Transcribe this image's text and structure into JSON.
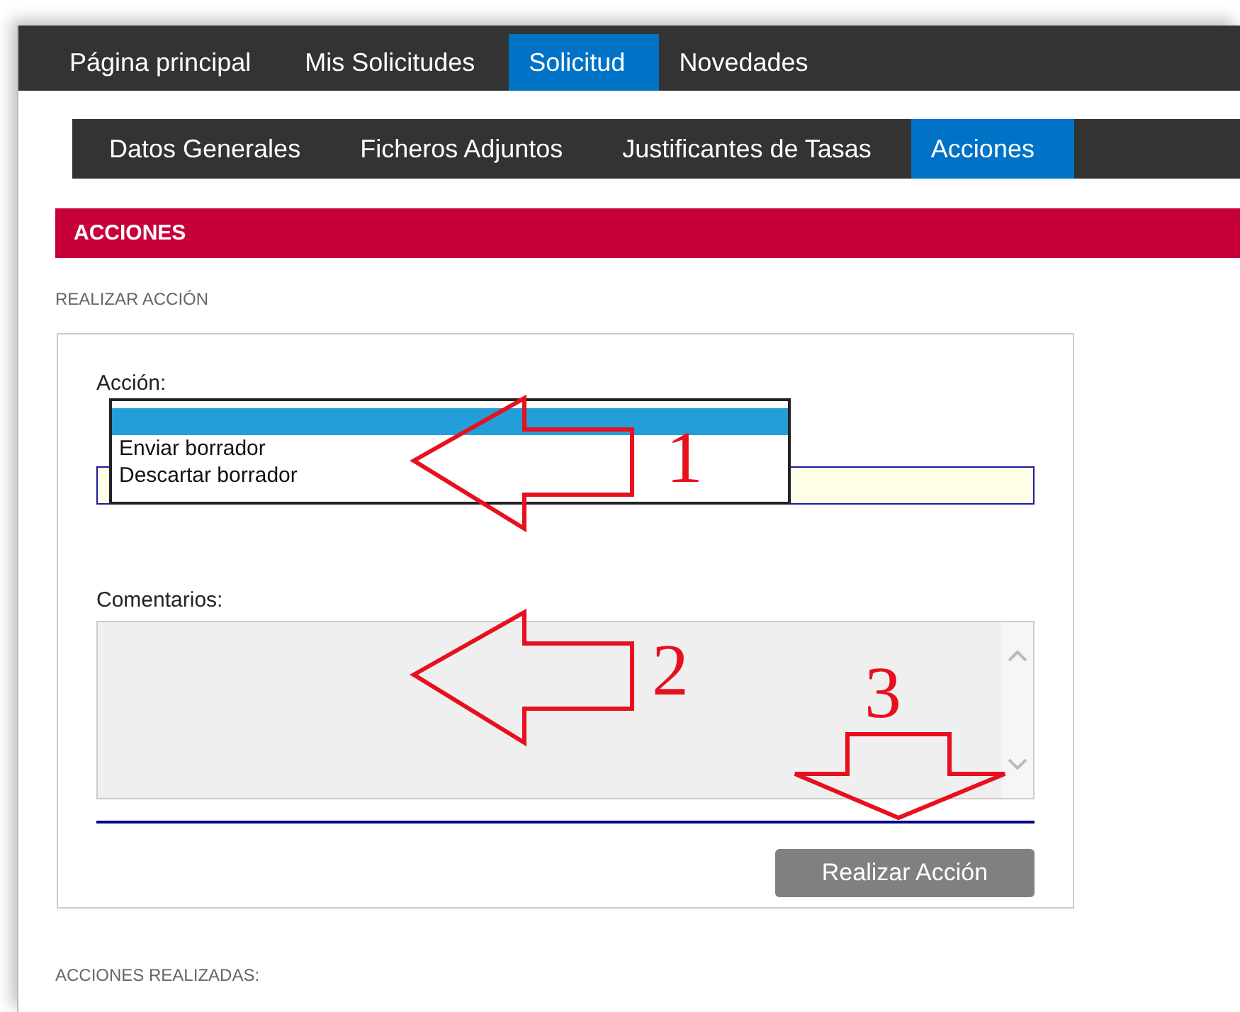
{
  "main_nav": [
    {
      "label": "Página principal",
      "selected": false
    },
    {
      "label": "Mis Solicitudes",
      "selected": false
    },
    {
      "label": "Solicitud",
      "selected": true
    },
    {
      "label": "Novedades",
      "selected": false
    }
  ],
  "sub_nav": [
    {
      "label": "Datos Generales",
      "selected": false
    },
    {
      "label": "Ficheros Adjuntos",
      "selected": false
    },
    {
      "label": "Justificantes de Tasas",
      "selected": false
    },
    {
      "label": "Acciones",
      "selected": true
    }
  ],
  "section_title": "ACCIONES",
  "subsection_title": "REALIZAR ACCIÓN",
  "form": {
    "action_label": "Acción:",
    "dropdown_options": [
      {
        "selected": true
      },
      {
        "label": "Enviar borrador",
        "selected": false
      },
      {
        "label": "Descartar borrador",
        "selected": false
      }
    ],
    "comments_label": "Comentarios:",
    "submit_button": "Realizar Acción"
  },
  "footer_title": "ACCIONES REALIZADAS:",
  "annotations": [
    {
      "label": "1",
      "kind": "left"
    },
    {
      "label": "2",
      "kind": "left"
    },
    {
      "label": "3",
      "kind": "down"
    }
  ]
}
